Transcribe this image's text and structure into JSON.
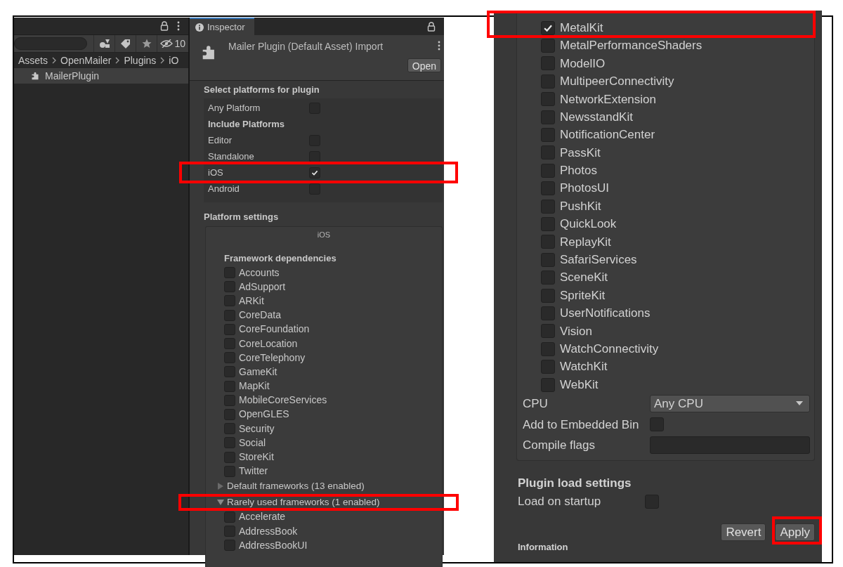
{
  "project_panel": {
    "filter_count": "10",
    "breadcrumb": [
      "Assets",
      "OpenMailer",
      "Plugins",
      "iO"
    ],
    "items": [
      {
        "label": "MailerPlugin",
        "selected": true
      }
    ]
  },
  "inspector": {
    "tab": "Inspector",
    "title": "Mailer Plugin (Default Asset) Import",
    "open_button": "Open",
    "platforms_heading": "Select platforms for plugin",
    "platform_rows": [
      {
        "kind": "checkbox",
        "label": "Any Platform",
        "checked": false,
        "highlighted": false
      },
      {
        "kind": "heading",
        "label": "Include Platforms"
      },
      {
        "kind": "checkbox",
        "label": "Editor",
        "checked": false,
        "highlighted": false
      },
      {
        "kind": "checkbox",
        "label": "Standalone",
        "checked": false,
        "highlighted": false
      },
      {
        "kind": "checkbox",
        "label": "iOS",
        "checked": true,
        "highlighted": true
      },
      {
        "kind": "checkbox",
        "label": "Android",
        "checked": false,
        "highlighted": false
      }
    ],
    "settings_heading": "Platform settings",
    "platform_tab": "iOS",
    "deps_heading": "Framework dependencies",
    "frameworks": [
      {
        "label": "Accounts",
        "checked": false
      },
      {
        "label": "AdSupport",
        "checked": false
      },
      {
        "label": "ARKit",
        "checked": false
      },
      {
        "label": "CoreData",
        "checked": false
      },
      {
        "label": "CoreFoundation",
        "checked": false
      },
      {
        "label": "CoreLocation",
        "checked": false
      },
      {
        "label": "CoreTelephony",
        "checked": false
      },
      {
        "label": "GameKit",
        "checked": false
      },
      {
        "label": "MapKit",
        "checked": false
      },
      {
        "label": "MobileCoreServices",
        "checked": false
      },
      {
        "label": "OpenGLES",
        "checked": false
      },
      {
        "label": "Security",
        "checked": false
      },
      {
        "label": "Social",
        "checked": false
      },
      {
        "label": "StoreKit",
        "checked": false
      },
      {
        "label": "Twitter",
        "checked": false
      }
    ],
    "groups": [
      {
        "label": "Default frameworks (13 enabled)",
        "expanded": false,
        "highlighted": false
      },
      {
        "label": "Rarely used frameworks (1 enabled)",
        "expanded": true,
        "highlighted": true,
        "frameworks": [
          {
            "label": "Accelerate",
            "checked": false
          },
          {
            "label": "AddressBook",
            "checked": false
          },
          {
            "label": "AddressBookUI",
            "checked": false
          }
        ]
      }
    ]
  },
  "inspector_continued": {
    "frameworks": [
      {
        "label": "MetalKit",
        "checked": true,
        "highlighted": true
      },
      {
        "label": "MetalPerformanceShaders",
        "checked": false,
        "highlighted": false
      },
      {
        "label": "ModelIO",
        "checked": false,
        "highlighted": false
      },
      {
        "label": "MultipeerConnectivity",
        "checked": false,
        "highlighted": false
      },
      {
        "label": "NetworkExtension",
        "checked": false,
        "highlighted": false
      },
      {
        "label": "NewsstandKit",
        "checked": false,
        "highlighted": false
      },
      {
        "label": "NotificationCenter",
        "checked": false,
        "highlighted": false
      },
      {
        "label": "PassKit",
        "checked": false,
        "highlighted": false
      },
      {
        "label": "Photos",
        "checked": false,
        "highlighted": false
      },
      {
        "label": "PhotosUI",
        "checked": false,
        "highlighted": false
      },
      {
        "label": "PushKit",
        "checked": false,
        "highlighted": false
      },
      {
        "label": "QuickLook",
        "checked": false,
        "highlighted": false
      },
      {
        "label": "ReplayKit",
        "checked": false,
        "highlighted": false
      },
      {
        "label": "SafariServices",
        "checked": false,
        "highlighted": false
      },
      {
        "label": "SceneKit",
        "checked": false,
        "highlighted": false
      },
      {
        "label": "SpriteKit",
        "checked": false,
        "highlighted": false
      },
      {
        "label": "UserNotifications",
        "checked": false,
        "highlighted": false
      },
      {
        "label": "Vision",
        "checked": false,
        "highlighted": false
      },
      {
        "label": "WatchConnectivity",
        "checked": false,
        "highlighted": false
      },
      {
        "label": "WatchKit",
        "checked": false,
        "highlighted": false
      },
      {
        "label": "WebKit",
        "checked": false,
        "highlighted": false
      }
    ],
    "fields": [
      {
        "kind": "dropdown",
        "label": "CPU",
        "value": "Any CPU"
      },
      {
        "kind": "checkbox",
        "label": "Add to Embedded Bin",
        "checked": false
      },
      {
        "kind": "text",
        "label": "Compile flags"
      }
    ],
    "load_heading": "Plugin load settings",
    "load_on_startup": {
      "label": "Load on startup",
      "checked": false
    },
    "buttons": [
      {
        "label": "Revert",
        "highlighted": false
      },
      {
        "label": "Apply",
        "highlighted": true
      }
    ],
    "next_heading": "Information"
  }
}
